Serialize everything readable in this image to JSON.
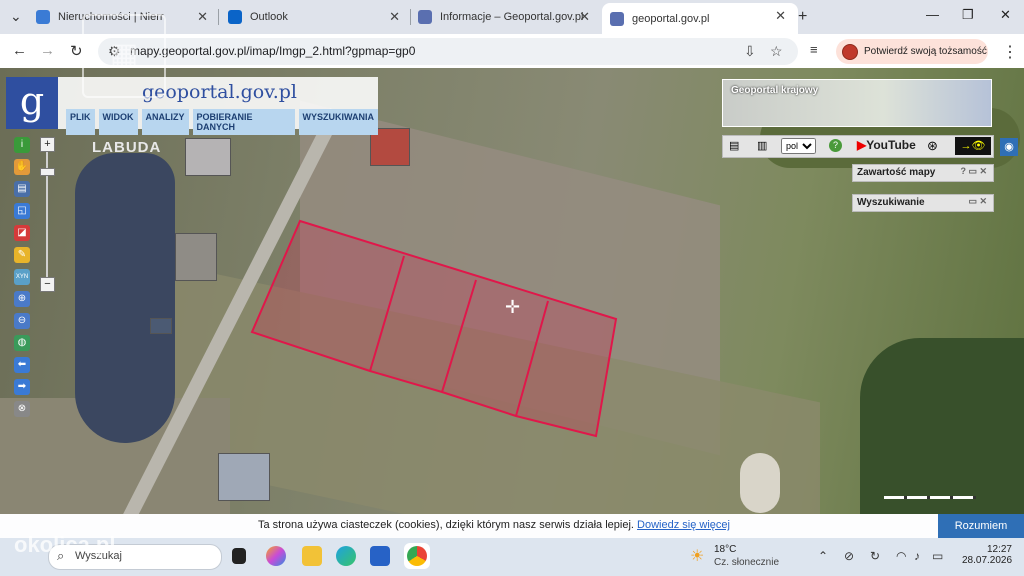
{
  "tabs": [
    {
      "label": "Nieruchomości | Nierr",
      "favicon_color": "#3a7bd5"
    },
    {
      "label": "Outlook",
      "favicon_color": "#0a64c8"
    },
    {
      "label": "Informacje – Geoportal.gov.pl",
      "favicon_color": "#5a6fb0"
    },
    {
      "label": "geoportal.gov.pl",
      "favicon_color": "#5a6fb0"
    }
  ],
  "address": {
    "url": "mapy.geoportal.gov.pl/imap/Imgp_2.html?gpmap=gp0"
  },
  "profile": {
    "label": "Potwierdź swoją tożsamość"
  },
  "geoportal": {
    "logo_letter": "g",
    "site_title": "geoportal.gov.pl",
    "menu": [
      "PLIK",
      "WIDOK",
      "ANALIZY",
      "POBIERANIE DANYCH",
      "WYSZUKIWANIA"
    ],
    "overview_title": "Geoportal krajowy",
    "language": "pol",
    "youtube_label": "YouTube",
    "panels": [
      "Zawartość mapy",
      "Wyszukiwanie"
    ]
  },
  "watermark": {
    "agency": "LABUDA",
    "site": "okolica.pl"
  },
  "cookie": {
    "text": "Ta strona używa ciasteczek (cookies), dzięki którym nasz serwis działa lepiej. ",
    "link": "Dowiedz się więcej",
    "button": "Rozumiem"
  },
  "taskbar": {
    "search_placeholder": "Wyszukaj",
    "temperature": "18°C",
    "weather": "Cz. słonecznie",
    "time": "12:27",
    "date": "28.07.2026"
  },
  "colors": {
    "parcel_outline": "#e0174a",
    "accent": "#2f6fb6",
    "brand": "#2f4fa0"
  }
}
